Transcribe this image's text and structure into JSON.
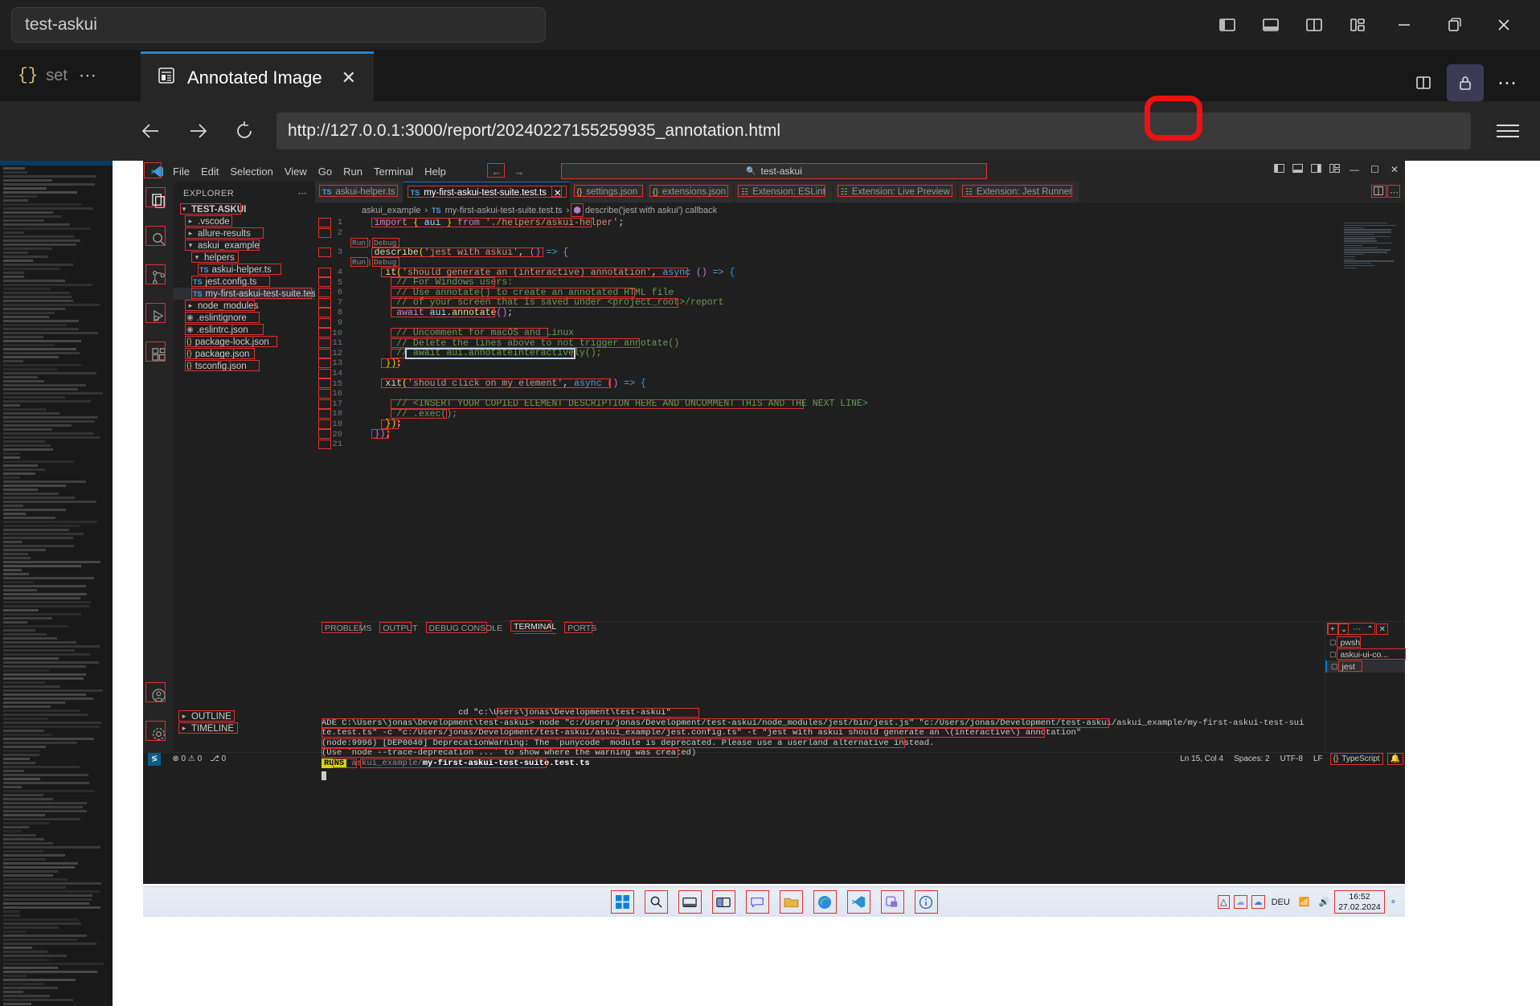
{
  "browser": {
    "window_title": "test-askui",
    "window_controls": {
      "minimize": "−",
      "restore": "❐",
      "close": "✕",
      "layout_icons": [
        "sidebar-left-icon",
        "panel-bottom-icon",
        "split-vertical-icon",
        "layout-grid-icon"
      ]
    },
    "ghost_tab": {
      "label": "set",
      "icon": "json-braces-icon",
      "overflow": "⋯"
    },
    "active_tab": {
      "title": "Annotated Image",
      "icon": "report-document-icon",
      "close": "✕"
    },
    "toolbar_right": {
      "split_icon": "split-editor-icon",
      "lock_icon": "lock-icon",
      "more": "⋯"
    },
    "url": "http://127.0.0.1:3000/report/20240227155259935_annotation.html",
    "nav": {
      "back": "←",
      "forward": "→",
      "reload": "↻",
      "menu": "hamburger-menu-icon"
    },
    "annotation_highlight_color": "#ee1111"
  },
  "vscode": {
    "menubar": [
      "File",
      "Edit",
      "Selection",
      "View",
      "Go",
      "Run",
      "Terminal",
      "Help"
    ],
    "search_box": "test-askui",
    "window_controls": [
      "–",
      "❐",
      "✕"
    ],
    "layout_icons": [
      "panel-left-icon",
      "panel-bottom-icon",
      "panel-right-icon",
      "customize-layout-icon"
    ],
    "activitybar": [
      "explorer-icon",
      "search-icon",
      "source-control-icon",
      "run-debug-icon",
      "extensions-icon",
      "accounts-icon",
      "settings-gear-icon"
    ],
    "sidebar": {
      "title": "EXPLORER",
      "more": "⋯",
      "root": "TEST-ASKUI",
      "tree": [
        {
          "label": ".vscode",
          "kind": "folder",
          "depth": 1,
          "expanded": false
        },
        {
          "label": "allure-results",
          "kind": "folder",
          "depth": 1,
          "expanded": false
        },
        {
          "label": "askui_example",
          "kind": "folder",
          "depth": 1,
          "expanded": true
        },
        {
          "label": "helpers",
          "kind": "folder",
          "depth": 2,
          "expanded": true
        },
        {
          "label": "askui-helper.ts",
          "kind": "ts",
          "depth": 3
        },
        {
          "label": "jest.config.ts",
          "kind": "ts",
          "depth": 2
        },
        {
          "label": "my-first-askui-test-suite.test.ts",
          "kind": "ts",
          "depth": 2,
          "selected": true
        },
        {
          "label": "node_modules",
          "kind": "folder",
          "depth": 1,
          "expanded": false
        },
        {
          "label": ".eslintignore",
          "kind": "file",
          "depth": 1
        },
        {
          "label": ".eslintrc.json",
          "kind": "file",
          "depth": 1
        },
        {
          "label": "package-lock.json",
          "kind": "json",
          "depth": 1
        },
        {
          "label": "package.json",
          "kind": "json",
          "depth": 1
        },
        {
          "label": "tsconfig.json",
          "kind": "tsconfig",
          "depth": 1
        }
      ],
      "bottom_sections": [
        "OUTLINE",
        "TIMELINE"
      ]
    },
    "editor_tabs": [
      {
        "label": "askui-helper.ts",
        "icon": "ts",
        "active": false
      },
      {
        "label": "my-first-askui-test-suite.test.ts",
        "icon": "ts",
        "active": true,
        "close": "✕"
      },
      {
        "label": "settings.json",
        "icon": "json",
        "active": false
      },
      {
        "label": "extensions.json",
        "icon": "json",
        "active": false
      },
      {
        "label": "Extension: ESLint",
        "icon": "extension",
        "active": false
      },
      {
        "label": "Extension: Live Preview",
        "icon": "extension",
        "active": false
      },
      {
        "label": "Extension: Jest Runner",
        "icon": "extension",
        "active": false
      }
    ],
    "editor_tabs_right": {
      "split": "split-editor-icon",
      "more": "⋯"
    },
    "breadcrumb": [
      "askui_example",
      "my-first-askui-test-suite.test.ts",
      "describe('jest with askui') callback"
    ],
    "code": {
      "codelens_label": "Run | Debug",
      "lines": [
        {
          "n": 1,
          "segments": [
            [
              "t-pl",
              "    "
            ],
            [
              "t-kw",
              "import"
            ],
            [
              "t-pl",
              " "
            ],
            [
              "t-br1",
              "{"
            ],
            [
              "t-var",
              " aui "
            ],
            [
              "t-br1",
              "}"
            ],
            [
              "t-pl",
              " "
            ],
            [
              "t-kw",
              "from"
            ],
            [
              "t-pl",
              " "
            ],
            [
              "t-str",
              "'./helpers/askui-helper'"
            ],
            [
              "t-pl",
              ";"
            ]
          ]
        },
        {
          "n": 2,
          "segments": []
        },
        {
          "n": 3,
          "codelens": true,
          "segments": [
            [
              "t-pl",
              "    "
            ],
            [
              "t-fn",
              "describe"
            ],
            [
              "t-br1",
              "("
            ],
            [
              "t-str",
              "'jest with askui'"
            ],
            [
              "t-pl",
              ", "
            ],
            [
              "t-br2",
              "()"
            ],
            [
              "t-kw2",
              " => "
            ],
            [
              "t-br2",
              "{"
            ]
          ]
        },
        {
          "n": 4,
          "codelens": true,
          "segments": [
            [
              "t-pl",
              "      "
            ],
            [
              "t-fn",
              "it"
            ],
            [
              "t-br1",
              "("
            ],
            [
              "t-str",
              "'should generate an (interactive) annotation'"
            ],
            [
              "t-pl",
              ", "
            ],
            [
              "t-kw2",
              "async"
            ],
            [
              "t-pl",
              " "
            ],
            [
              "t-br2",
              "()"
            ],
            [
              "t-kw2",
              " => "
            ],
            [
              "t-br3",
              "{"
            ]
          ]
        },
        {
          "n": 5,
          "segments": [
            [
              "t-pl",
              "        "
            ],
            [
              "t-com",
              "// For Windows users:"
            ]
          ]
        },
        {
          "n": 6,
          "segments": [
            [
              "t-pl",
              "        "
            ],
            [
              "t-com",
              "// Use annotate() to create an annotated HTML file"
            ]
          ]
        },
        {
          "n": 7,
          "segments": [
            [
              "t-pl",
              "        "
            ],
            [
              "t-com",
              "// of your screen that is saved under <project_root>/report"
            ]
          ]
        },
        {
          "n": 8,
          "segments": [
            [
              "t-pl",
              "        "
            ],
            [
              "t-kw",
              "await"
            ],
            [
              "t-pl",
              " "
            ],
            [
              "t-var",
              "aui"
            ],
            [
              "t-pl",
              "."
            ],
            [
              "t-fn",
              "annotate"
            ],
            [
              "t-br2",
              "()"
            ],
            [
              "t-pl",
              ";"
            ]
          ]
        },
        {
          "n": 9,
          "segments": []
        },
        {
          "n": 10,
          "segments": [
            [
              "t-pl",
              "        "
            ],
            [
              "t-com",
              "// Uncomment for macOS and Linux"
            ]
          ]
        },
        {
          "n": 11,
          "segments": [
            [
              "t-pl",
              "        "
            ],
            [
              "t-com",
              "// Delete the lines above to not trigger annotate()"
            ]
          ]
        },
        {
          "n": 12,
          "segments": [
            [
              "t-pl",
              "        "
            ],
            [
              "t-com",
              "// await aui.annotateInteractively();"
            ]
          ],
          "blue_box": true
        },
        {
          "n": 13,
          "segments": [
            [
              "t-pl",
              "      "
            ],
            [
              "t-br1",
              "})"
            ],
            [
              "t-pl",
              ";"
            ]
          ]
        },
        {
          "n": 14,
          "segments": []
        },
        {
          "n": 15,
          "segments": [
            [
              "t-pl",
              "      "
            ],
            [
              "t-fn",
              "xit"
            ],
            [
              "t-br1",
              "("
            ],
            [
              "t-str",
              "'should click on my element'"
            ],
            [
              "t-pl",
              ", "
            ],
            [
              "t-kw2",
              "async"
            ],
            [
              "t-pl",
              " "
            ],
            [
              "t-br2",
              "()"
            ],
            [
              "t-kw2",
              " => "
            ],
            [
              "t-br3",
              "{"
            ]
          ]
        },
        {
          "n": 16,
          "segments": []
        },
        {
          "n": 17,
          "segments": [
            [
              "t-pl",
              "        "
            ],
            [
              "t-com",
              "// <INSERT YOUR COPIED ELEMENT DESCRIPTION HERE AND UNCOMMENT THIS AND THE NEXT LINE>"
            ]
          ]
        },
        {
          "n": 18,
          "segments": [
            [
              "t-pl",
              "        "
            ],
            [
              "t-com",
              "// .exec();"
            ]
          ]
        },
        {
          "n": 19,
          "segments": [
            [
              "t-pl",
              "      "
            ],
            [
              "t-br1",
              "})"
            ],
            [
              "t-pl",
              ";"
            ]
          ]
        },
        {
          "n": 20,
          "segments": [
            [
              "t-pl",
              "    "
            ],
            [
              "t-br2",
              "})"
            ],
            [
              "t-pl",
              ";"
            ]
          ]
        },
        {
          "n": 21,
          "segments": []
        }
      ]
    },
    "panel": {
      "tabs": [
        "PROBLEMS",
        "OUTPUT",
        "DEBUG CONSOLE",
        "TERMINAL",
        "PORTS"
      ],
      "active_tab": "TERMINAL",
      "toolbar": [
        "add-terminal-icon",
        "chevron-down-icon",
        "⋯",
        "chevron-up-icon",
        "close-icon"
      ],
      "terminals": [
        "pwsh",
        "askui-ui-co...",
        "jest"
      ],
      "active_terminal": "jest",
      "output": [
        "                           cd \"c:\\Users\\jonas\\Development\\test-askui\"",
        "ADE C:\\Users\\jonas\\Development\\test-askui> node \"c:/Users/jonas/Development/test-askui/node_modules/jest/bin/jest.js\" \"c:/Users/jonas/Development/test-askui/askui_example/my-first-askui-test-sui",
        "te.test.ts\" -c \"c:/Users/jonas/Development/test-askui/askui_example/jest.config.ts\" -t \"jest with askui should generate an \\(interactive\\) annotation\"",
        "(node:9996) [DEP0040] DeprecationWarning: The `punycode` module is deprecated. Please use a userland alternative instead.",
        "(Use `node --trace-deprecation ...` to show where the warning was created)"
      ],
      "runs_badge": "RUNS",
      "runs_path_prefix": "askui_example/",
      "runs_path_file": "my-first-askui-test-suite.test.ts"
    },
    "statusbar": {
      "remote": "≶",
      "problems": "⊗ 0  ⚠ 0",
      "ports": "⎇ 0",
      "position": "Ln 15, Col 4",
      "spaces": "Spaces: 2",
      "encoding": "UTF-8",
      "eol": "LF",
      "language": "TypeScript",
      "bell": "bell-icon"
    }
  },
  "taskbar": {
    "icons": [
      "windows-start-icon",
      "search-icon",
      "task-view-icon",
      "widgets-icon",
      "chat-icon",
      "file-explorer-icon",
      "edge-icon",
      "vscode-icon",
      "askui-icon",
      "info-icon"
    ],
    "tray": [
      "show-hidden-icon",
      "cloud-icon",
      "onedrive-icon",
      "network-icon",
      "volume-icon"
    ],
    "language": "DEU",
    "clock_time": "16:52",
    "clock_date": "27.02.2024",
    "notification": "notification-icon"
  }
}
